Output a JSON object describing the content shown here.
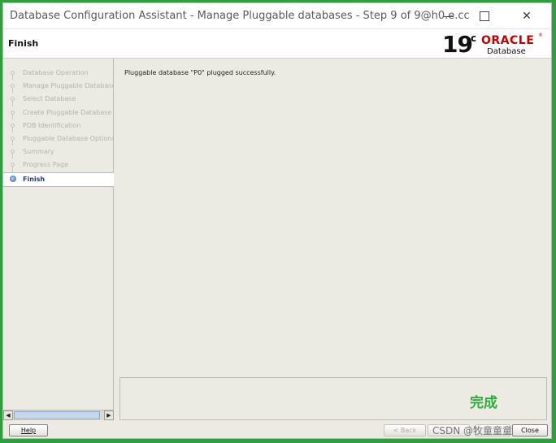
{
  "window": {
    "title": "Database Configuration Assistant - Manage Pluggable databases - Step 9 of 9@h0.e.cc",
    "controls": {
      "minimize": "minimize",
      "maximize": "maximize",
      "close": "✕"
    }
  },
  "header": {
    "page_title": "Finish",
    "brand": {
      "version_number": "19",
      "version_suffix": "c",
      "vendor": "ORACLE",
      "registered": "®",
      "product": "Database"
    }
  },
  "sidebar": {
    "steps": [
      {
        "label": "Database Operation",
        "state": "done"
      },
      {
        "label": "Manage Pluggable Database",
        "state": "done"
      },
      {
        "label": "Select Database",
        "state": "done"
      },
      {
        "label": "Create Pluggable Database",
        "state": "done"
      },
      {
        "label": "PDB Identification",
        "state": "done"
      },
      {
        "label": "Pluggable Database Options",
        "state": "done"
      },
      {
        "label": "Summary",
        "state": "done"
      },
      {
        "label": "Progress Page",
        "state": "done"
      },
      {
        "label": "Finish",
        "state": "active"
      }
    ],
    "scroll": {
      "left": "◀",
      "right": "▶"
    }
  },
  "content": {
    "message": "Pluggable database \"P0\" plugged successfully.",
    "overlay_text": "完成"
  },
  "buttons": {
    "help": "Help",
    "back": "< Back",
    "next": "",
    "finish": "",
    "close": "Close"
  },
  "watermark": "CSDN @牧童童童",
  "colors": {
    "outer_border": "#2f9e3f",
    "oracle_red": "#c00000",
    "active_step": "#1b3f8a",
    "overlay_green": "#2fae3e"
  }
}
